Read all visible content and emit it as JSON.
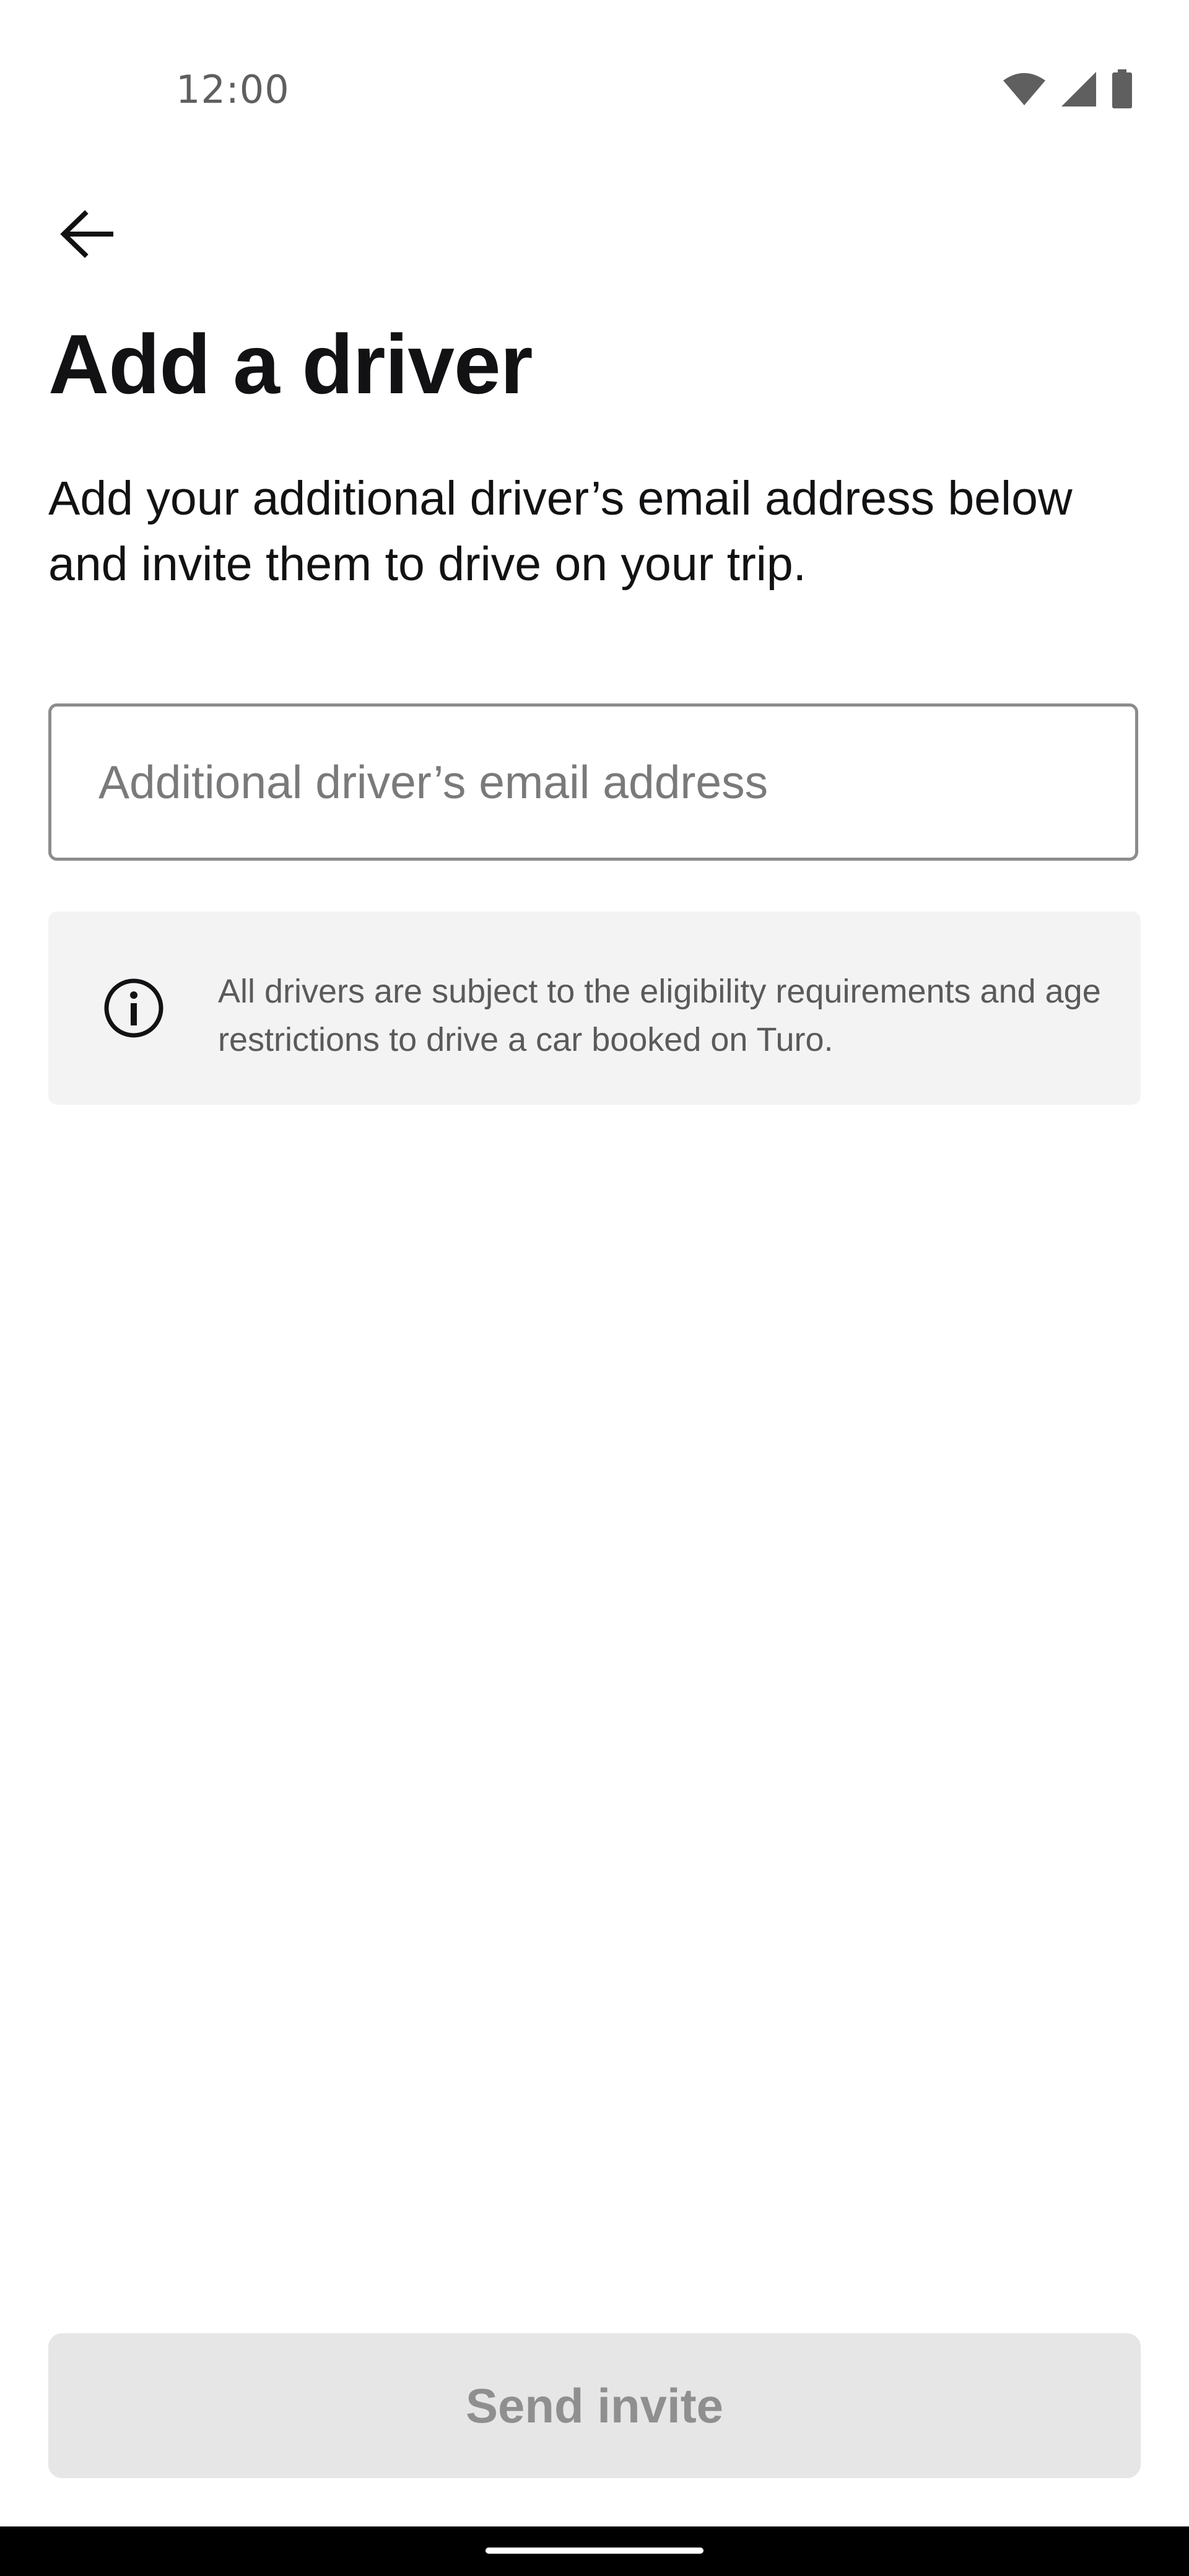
{
  "status_bar": {
    "time": "12:00",
    "icons": [
      "wifi-icon",
      "cellular-signal-icon",
      "battery-icon"
    ]
  },
  "header": {
    "back_icon": "arrow-left-icon"
  },
  "main": {
    "title": "Add a driver",
    "description": "Add your additional driver’s email address below and invite them to drive on your trip.",
    "email_field": {
      "placeholder": "Additional driver’s email address",
      "value": ""
    },
    "info_box": {
      "icon": "info-icon",
      "text": "All drivers are subject to the eligibility requirements and age restrictions to drive a car booked on Turo."
    }
  },
  "footer": {
    "send_button_label": "Send invite",
    "send_button_state": "disabled"
  },
  "colors": {
    "text_primary": "#121214",
    "text_secondary": "#5a5a5c",
    "field_border": "#8c8c8e",
    "info_background": "#f3f3f3",
    "button_disabled_background": "#e6e6e6",
    "button_disabled_text": "#8f8f8f"
  }
}
